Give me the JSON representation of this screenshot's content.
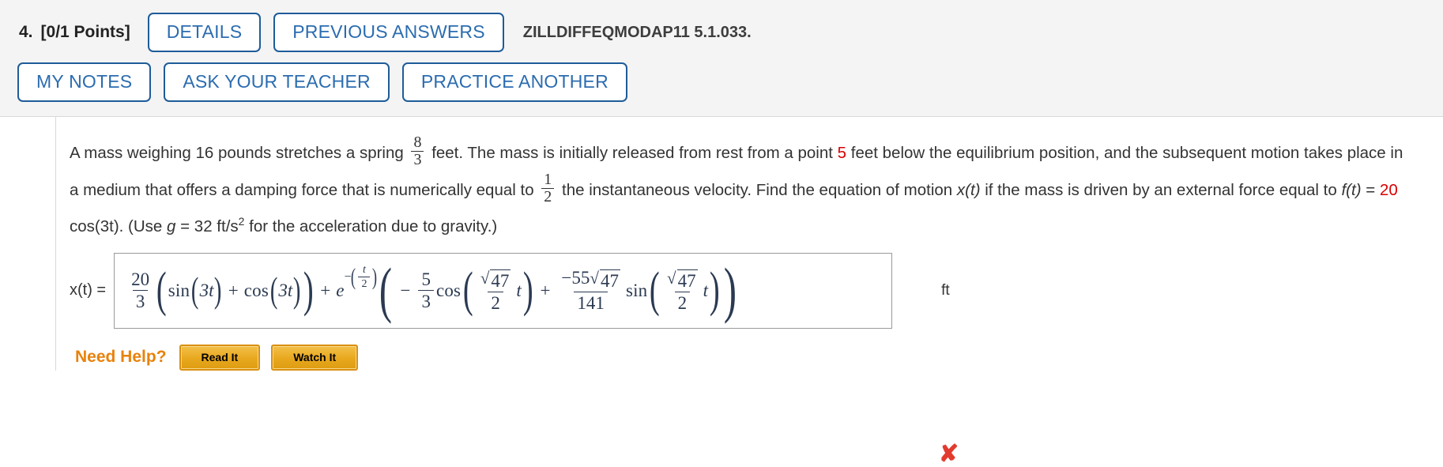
{
  "header": {
    "question_number": "4.",
    "points": "[0/1 Points]",
    "buttons_row1": [
      {
        "label": "DETAILS",
        "name": "details-button"
      },
      {
        "label": "PREVIOUS ANSWERS",
        "name": "previous-answers-button"
      }
    ],
    "assignment_code": "ZILLDIFFEQMODAP11 5.1.033.",
    "buttons_row2": [
      {
        "label": "MY NOTES",
        "name": "my-notes-button"
      },
      {
        "label": "ASK YOUR TEACHER",
        "name": "ask-your-teacher-button"
      },
      {
        "label": "PRACTICE ANOTHER",
        "name": "practice-another-button"
      }
    ]
  },
  "problem": {
    "seg1": "A mass weighing 16 pounds stretches a spring",
    "frac1_num": "8",
    "frac1_den": "3",
    "seg2": "feet. The mass is initially released from rest from a point",
    "distance_value": "5",
    "seg3": "feet below the equilibrium position, and the subsequent motion takes place in a medium that offers a damping force that is numerically equal to",
    "frac2_num": "1",
    "frac2_den": "2",
    "seg4": "the instantaneous velocity. Find the equation of motion",
    "motion_var": "x(t)",
    "seg5": "if the mass is driven by an external force equal to",
    "force_fn": "f(t)",
    "equals": "=",
    "force_amplitude": "20",
    "force_rest": "cos(3t). (Use",
    "gravity_var": "g",
    "gravity_value": "= 32 ft/s",
    "gravity_exp": "2",
    "seg6": "for the acceleration due to gravity.)"
  },
  "answer": {
    "label": "x(t)  =",
    "unit": "ft",
    "status_icon": "✘",
    "status_color": "#e23b2e",
    "math": {
      "coef_num": "20",
      "coef_den": "3",
      "sin_arg": "3t",
      "sin_name": "sin",
      "cos_name": "cos",
      "cos_arg": "3t",
      "plus": "+",
      "e_base": "e",
      "exp_minus": "−",
      "exp_num": "t",
      "exp_den": "2",
      "inner_minus": "−",
      "c1_num": "5",
      "c1_den": "3",
      "radicand": "47",
      "freq_den": "2",
      "t_var": "t",
      "c2_num": "−55",
      "c2_den": "141"
    }
  },
  "need_help": {
    "label": "Need Help?",
    "buttons": [
      {
        "label": "Read It",
        "name": "read-it-button"
      },
      {
        "label": "Watch It",
        "name": "watch-it-button"
      }
    ]
  }
}
